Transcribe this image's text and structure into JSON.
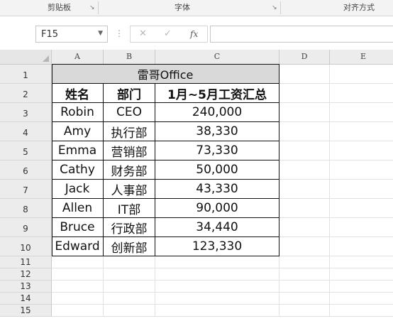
{
  "ribbon": {
    "groups": [
      {
        "label": "剪贴板"
      },
      {
        "label": "字体"
      },
      {
        "label": "对齐方式"
      }
    ]
  },
  "formula_bar": {
    "name_box": "F15",
    "cancel_icon": "✕",
    "enter_icon": "✓",
    "fx_label": "fx",
    "formula_value": ""
  },
  "columns": [
    "A",
    "B",
    "C",
    "D",
    "E"
  ],
  "rows": [
    "1",
    "2",
    "3",
    "4",
    "5",
    "6",
    "7",
    "8",
    "9",
    "10",
    "11",
    "12",
    "13",
    "14",
    "15"
  ],
  "table": {
    "title": "雷哥Office",
    "headers": [
      "姓名",
      "部门",
      "1月~5月工资汇总"
    ],
    "records": [
      {
        "name": "Robin",
        "dept": "CEO",
        "salary": "240,000"
      },
      {
        "name": "Amy",
        "dept": "执行部",
        "salary": "38,330"
      },
      {
        "name": "Emma",
        "dept": "营销部",
        "salary": "73,330"
      },
      {
        "name": "Cathy",
        "dept": "财务部",
        "salary": "50,000"
      },
      {
        "name": "Jack",
        "dept": "人事部",
        "salary": "43,330"
      },
      {
        "name": "Allen",
        "dept": "IT部",
        "salary": "90,000"
      },
      {
        "name": "Bruce",
        "dept": "行政部",
        "salary": "34,440"
      },
      {
        "name": "Edward",
        "dept": "创新部",
        "salary": "123,330"
      }
    ]
  },
  "colors": {
    "title_fill": "#d9d9d9",
    "header_bg": "#ececec",
    "border": "#111111"
  }
}
